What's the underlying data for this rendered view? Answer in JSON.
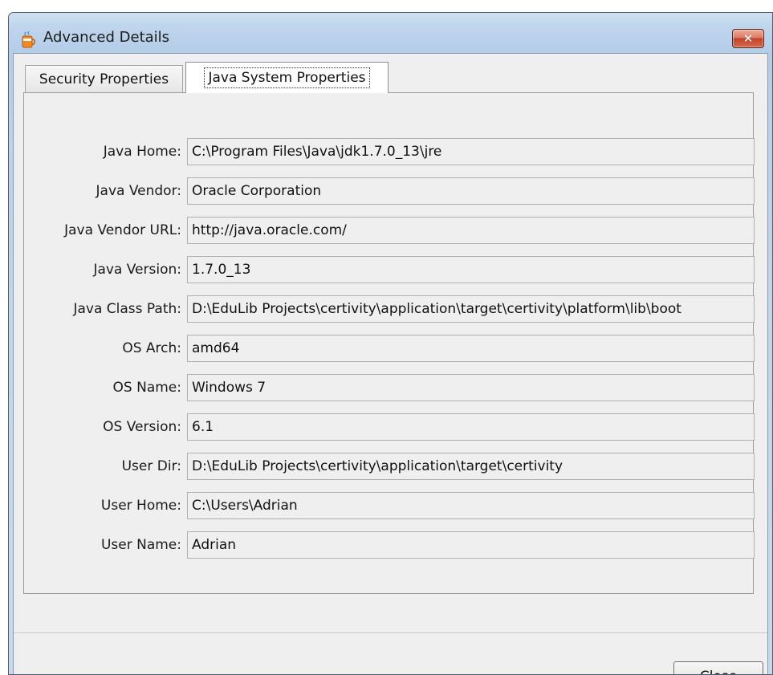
{
  "window": {
    "title": "Advanced Details",
    "close_glyph": "✕"
  },
  "tabs": [
    {
      "label": "Security Properties",
      "active": false
    },
    {
      "label": "Java System Properties",
      "active": true
    }
  ],
  "properties": [
    {
      "label": "Java Home:",
      "value": "C:\\Program Files\\Java\\jdk1.7.0_13\\jre"
    },
    {
      "label": "Java Vendor:",
      "value": "Oracle Corporation"
    },
    {
      "label": "Java Vendor URL:",
      "value": "http://java.oracle.com/"
    },
    {
      "label": "Java Version:",
      "value": "1.7.0_13"
    },
    {
      "label": "Java Class Path:",
      "value": "D:\\EduLib Projects\\certivity\\application\\target\\certivity\\platform\\lib\\boot"
    },
    {
      "label": "OS Arch:",
      "value": "amd64"
    },
    {
      "label": "OS Name:",
      "value": "Windows 7"
    },
    {
      "label": "OS Version:",
      "value": "6.1"
    },
    {
      "label": "User Dir:",
      "value": "D:\\EduLib Projects\\certivity\\application\\target\\certivity"
    },
    {
      "label": "User Home:",
      "value": "C:\\Users\\Adrian"
    },
    {
      "label": "User Name:",
      "value": "Adrian"
    }
  ],
  "footer": {
    "close_label": "Close"
  },
  "icons": {
    "app": "java-cup-icon",
    "close": "close-icon"
  }
}
